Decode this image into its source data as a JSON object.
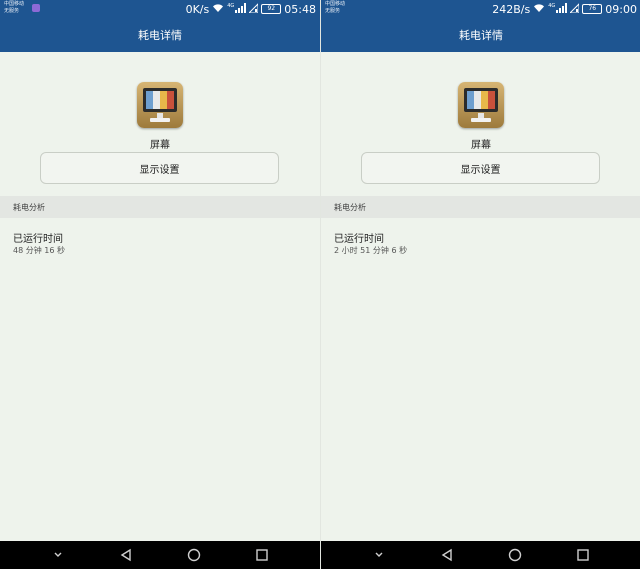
{
  "colors": {
    "header_blue": "#1e5591",
    "page_bg": "#eef3ec",
    "section_bg": "#e3e6e2",
    "nav_bg": "#000000",
    "icon_bars": [
      "#6f9fcf",
      "#e9e9e9",
      "#e7b84a",
      "#c9513b"
    ]
  },
  "screens": [
    {
      "status": {
        "carrier_line1": "中国移动",
        "carrier_line2": "无服务",
        "speed": "0K/s",
        "signal_label": "4G",
        "battery": "92",
        "time": "05:48"
      },
      "title": "耗电详情",
      "item_name": "屏幕",
      "settings_button": "显示设置",
      "section": "耗电分析",
      "runtime_label": "已运行时间",
      "runtime_value": "48 分钟 16 秒"
    },
    {
      "status": {
        "carrier_line1": "中国移动",
        "carrier_line2": "无服务",
        "speed": "242B/s",
        "signal_label": "4G",
        "battery": "76",
        "time": "09:00"
      },
      "title": "耗电详情",
      "item_name": "屏幕",
      "settings_button": "显示设置",
      "section": "耗电分析",
      "runtime_label": "已运行时间",
      "runtime_value": "2 小时 51 分钟 6 秒"
    }
  ]
}
